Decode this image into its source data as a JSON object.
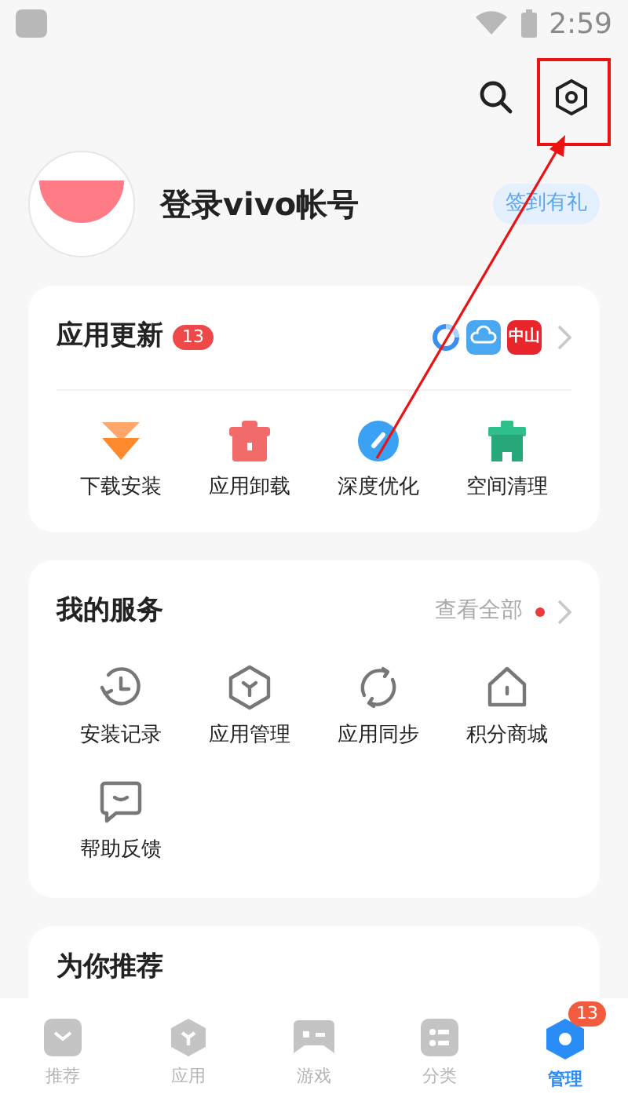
{
  "status_bar": {
    "time": "2:59"
  },
  "profile": {
    "name": "登录vivo帐号",
    "badge": "签到有礼"
  },
  "updates": {
    "title": "应用更新",
    "count": "13",
    "apps": [
      {
        "kind": "ring"
      },
      {
        "kind": "cloud"
      },
      {
        "kind": "logo",
        "label": "中山"
      }
    ],
    "tools": [
      {
        "kind": "download",
        "label": "下载安装"
      },
      {
        "kind": "uninstall",
        "label": "应用卸载"
      },
      {
        "kind": "optimize",
        "label": "深度优化"
      },
      {
        "kind": "clean",
        "label": "空间清理"
      }
    ]
  },
  "services": {
    "title": "我的服务",
    "link": "查看全部",
    "items": [
      {
        "kind": "history",
        "label": "安装记录"
      },
      {
        "kind": "manage",
        "label": "应用管理"
      },
      {
        "kind": "sync",
        "label": "应用同步"
      },
      {
        "kind": "store",
        "label": "积分商城"
      },
      {
        "kind": "feedback",
        "label": "帮助反馈"
      }
    ]
  },
  "recommend": {
    "title": "为你推荐"
  },
  "nav": [
    {
      "kind": "recommend",
      "label": "推荐",
      "selected": false
    },
    {
      "kind": "apps",
      "label": "应用",
      "selected": false
    },
    {
      "kind": "games",
      "label": "游戏",
      "selected": false
    },
    {
      "kind": "category",
      "label": "分类",
      "selected": false
    },
    {
      "kind": "manage",
      "label": "管理",
      "selected": true,
      "badge": "13"
    }
  ]
}
